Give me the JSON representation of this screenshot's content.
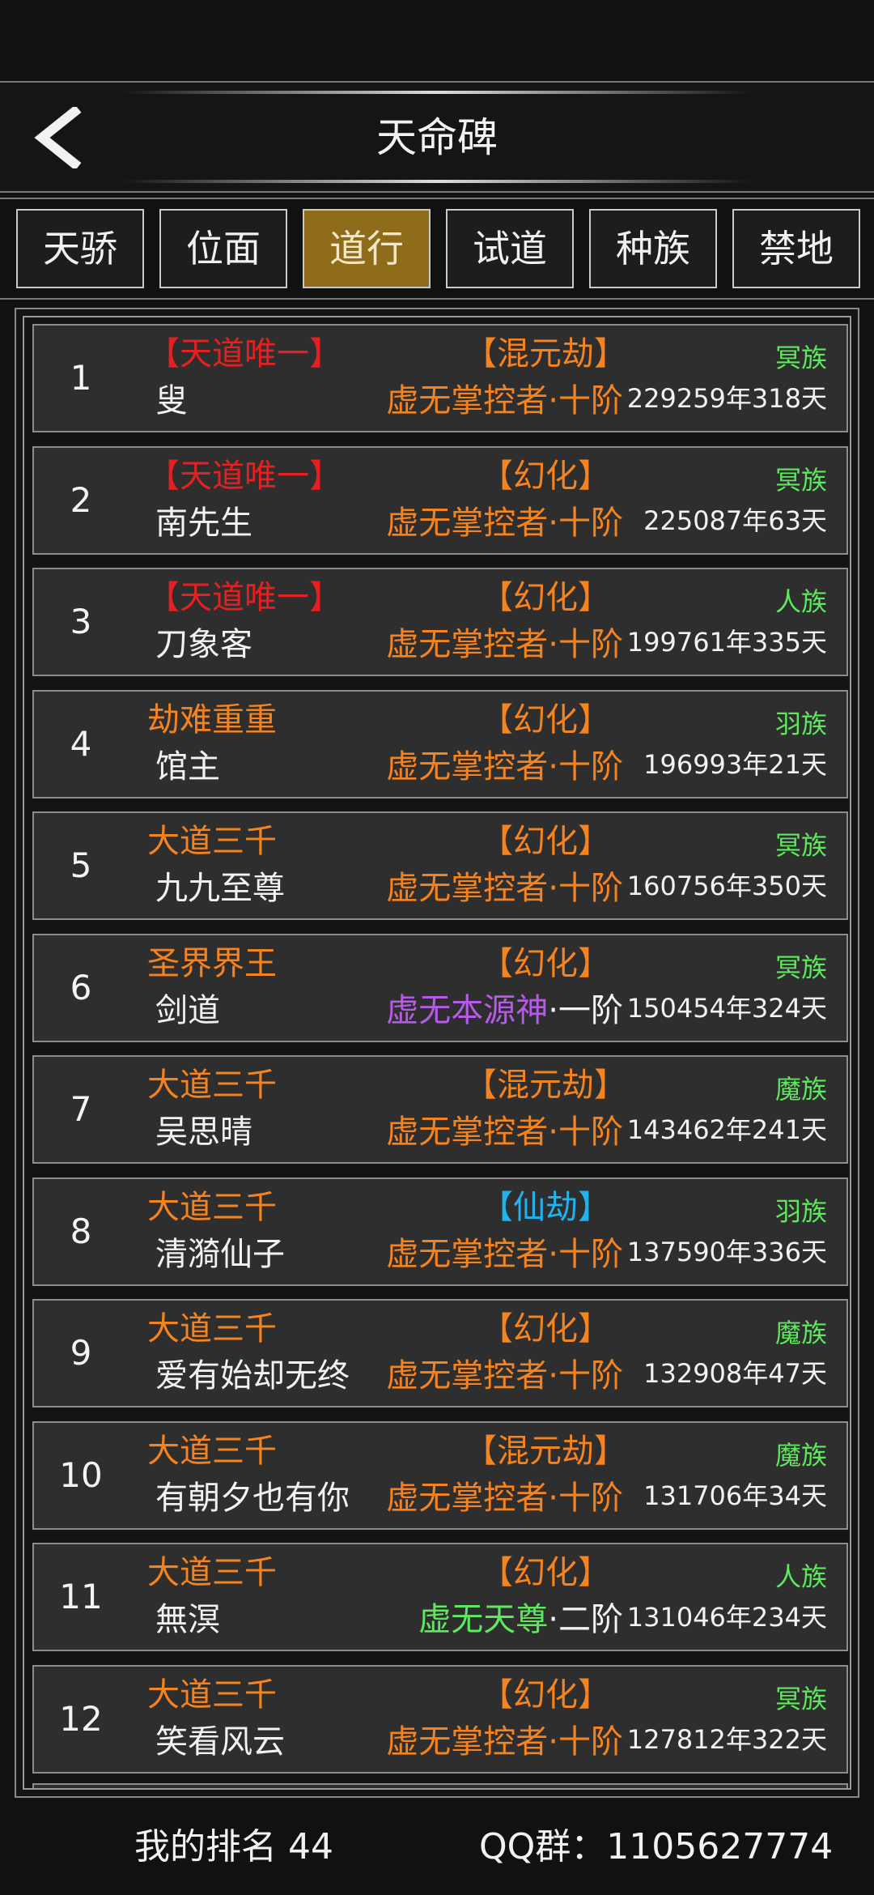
{
  "colors": {
    "red": "#e62020",
    "orange": "#f5831f",
    "purple": "#b55be8",
    "green": "#5ee85e",
    "cyan": "#1fb4f0",
    "active_tab": "#8f6c1a"
  },
  "header": {
    "title": "天命碑",
    "back_icon": "chevron-left-icon"
  },
  "tabs": [
    {
      "label": "天骄",
      "active": false
    },
    {
      "label": "位面",
      "active": false
    },
    {
      "label": "道行",
      "active": true
    },
    {
      "label": "试道",
      "active": false
    },
    {
      "label": "种族",
      "active": false
    },
    {
      "label": "禁地",
      "active": false
    }
  ],
  "rows": [
    {
      "rank": "1",
      "title": "【天道唯一】",
      "title_color": "#e62020",
      "name": "叟",
      "dao": "【混元劫】",
      "dao_color": "#f5831f",
      "realm": "虚无掌控者",
      "realm_color": "#f5831f",
      "stage": "·十阶",
      "stage_color": "#f5831f",
      "race": "冥族",
      "age": "229259年318天"
    },
    {
      "rank": "2",
      "title": "【天道唯一】",
      "title_color": "#e62020",
      "name": "南先生",
      "dao": "【幻化】",
      "dao_color": "#f5831f",
      "realm": "虚无掌控者",
      "realm_color": "#f5831f",
      "stage": "·十阶",
      "stage_color": "#f5831f",
      "race": "冥族",
      "age": "225087年63天"
    },
    {
      "rank": "3",
      "title": "【天道唯一】",
      "title_color": "#e62020",
      "name": "刀象客",
      "dao": "【幻化】",
      "dao_color": "#f5831f",
      "realm": "虚无掌控者",
      "realm_color": "#f5831f",
      "stage": "·十阶",
      "stage_color": "#f5831f",
      "race": "人族",
      "age": "199761年335天"
    },
    {
      "rank": "4",
      "title": "劫难重重",
      "title_color": "#f5831f",
      "name": "馆主",
      "dao": "【幻化】",
      "dao_color": "#f5831f",
      "realm": "虚无掌控者",
      "realm_color": "#f5831f",
      "stage": "·十阶",
      "stage_color": "#f5831f",
      "race": "羽族",
      "age": "196993年21天"
    },
    {
      "rank": "5",
      "title": "大道三千",
      "title_color": "#f5831f",
      "name": "九九至尊",
      "dao": "【幻化】",
      "dao_color": "#f5831f",
      "realm": "虚无掌控者",
      "realm_color": "#f5831f",
      "stage": "·十阶",
      "stage_color": "#f5831f",
      "race": "冥族",
      "age": "160756年350天"
    },
    {
      "rank": "6",
      "title": "圣界界王",
      "title_color": "#f5831f",
      "name": "剑道",
      "dao": "【幻化】",
      "dao_color": "#f5831f",
      "realm": "虚无本源神",
      "realm_color": "#b55be8",
      "stage": "·一阶",
      "stage_color": "#f2f2f2",
      "race": "冥族",
      "age": "150454年324天"
    },
    {
      "rank": "7",
      "title": "大道三千",
      "title_color": "#f5831f",
      "name": "吴思晴",
      "dao": "【混元劫】",
      "dao_color": "#f5831f",
      "realm": "虚无掌控者",
      "realm_color": "#f5831f",
      "stage": "·十阶",
      "stage_color": "#f5831f",
      "race": "魔族",
      "age": "143462年241天"
    },
    {
      "rank": "8",
      "title": "大道三千",
      "title_color": "#f5831f",
      "name": "清漪仙子",
      "dao": "【仙劫】",
      "dao_color": "#1fb4f0",
      "realm": "虚无掌控者",
      "realm_color": "#f5831f",
      "stage": "·十阶",
      "stage_color": "#f5831f",
      "race": "羽族",
      "age": "137590年336天"
    },
    {
      "rank": "9",
      "title": "大道三千",
      "title_color": "#f5831f",
      "name": "爱有始却无终",
      "dao": "【幻化】",
      "dao_color": "#f5831f",
      "realm": "虚无掌控者",
      "realm_color": "#f5831f",
      "stage": "·十阶",
      "stage_color": "#f5831f",
      "race": "魔族",
      "age": "132908年47天"
    },
    {
      "rank": "10",
      "title": "大道三千",
      "title_color": "#f5831f",
      "name": "有朝夕也有你",
      "dao": "【混元劫】",
      "dao_color": "#f5831f",
      "realm": "虚无掌控者",
      "realm_color": "#f5831f",
      "stage": "·十阶",
      "stage_color": "#f5831f",
      "race": "魔族",
      "age": "131706年34天"
    },
    {
      "rank": "11",
      "title": "大道三千",
      "title_color": "#f5831f",
      "name": "無溟",
      "dao": "【幻化】",
      "dao_color": "#f5831f",
      "realm": "虚无天尊",
      "realm_color": "#5ee85e",
      "stage": "·二阶",
      "stage_color": "#f2f2f2",
      "race": "人族",
      "age": "131046年234天"
    },
    {
      "rank": "12",
      "title": "大道三千",
      "title_color": "#f5831f",
      "name": "笑看风云",
      "dao": "【幻化】",
      "dao_color": "#f5831f",
      "realm": "虚无掌控者",
      "realm_color": "#f5831f",
      "stage": "·十阶",
      "stage_color": "#f5831f",
      "race": "冥族",
      "age": "127812年322天"
    }
  ],
  "footer": {
    "my_rank": "我的排名 44",
    "qq_group": "QQ群：1105627774"
  }
}
